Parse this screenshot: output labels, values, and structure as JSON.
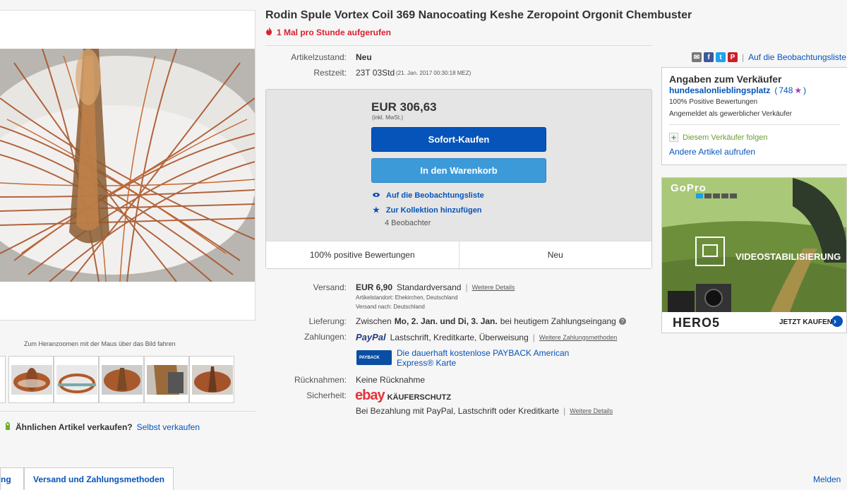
{
  "gallery": {
    "zoom_hint": "Zum Heranzoomen mit der Maus über das Bild fahren",
    "sell_question": "Ähnlichen Artikel verkaufen?",
    "sell_link": "Selbst verkaufen"
  },
  "tabs": {
    "tab1": "ng",
    "tab2": "Versand und Zahlungsmethoden",
    "report": "Melden"
  },
  "item": {
    "title": "Rodin Spule Vortex Coil 369 Nanocoating Keshe Zeropoint Orgonit Chembuster",
    "views": "1 Mal pro Stunde aufgerufen",
    "condition_label": "Artikelzustand:",
    "condition": "Neu",
    "time_label": "Restzeit:",
    "time_left": "23T 03Std",
    "end_date": "(21. Jan. 2017   00:30:18 MEZ)"
  },
  "share": {
    "watch_link": "Auf die Beobachtungsliste"
  },
  "buybox": {
    "price": "EUR 306,63",
    "vat": "(inkl. MwSt.)",
    "buy_now": "Sofort-Kaufen",
    "add_to_cart": "In den Warenkorb",
    "watchlist": "Auf die Beobachtungsliste",
    "collection": "Zur Kollektion hinzufügen",
    "watchers": "4 Beobachter",
    "positive": "100% positive Bewertungen",
    "condition": "Neu"
  },
  "shipping": {
    "label": "Versand:",
    "price": "EUR 6,90",
    "method": "Standardversand",
    "details": "Weitere Details",
    "location": "Artikelstandort:  Ehekirchen, Deutschland",
    "ships_to": "Versand nach:  Deutschland"
  },
  "delivery": {
    "label": "Lieferung:",
    "prefix": "Zwischen",
    "dates": "Mo, 2. Jan. und Di, 3. Jan.",
    "suffix": "bei heutigem Zahlungseingang"
  },
  "payments": {
    "label": "Zahlungen:",
    "paypal": "PayPal",
    "methods": "Lastschrift,  Kreditkarte,  Überweisung",
    "more": "Weitere Zahlungsmethoden",
    "payback_logo": "PAYBACK",
    "payback_text_1": "Die dauerhaft kostenlose PAYBACK American",
    "payback_text_2": "Express® Karte"
  },
  "returns": {
    "label": "Rücknahmen:",
    "value": "Keine Rücknahme"
  },
  "security": {
    "label": "Sicherheit:",
    "ebay": "ebay",
    "protection": "KÄUFERSCHUTZ",
    "text": "Bei Bezahlung mit PayPal, Lastschrift oder Kreditkarte",
    "details": "Weitere Details"
  },
  "seller": {
    "heading": "Angaben zum Verkäufer",
    "name": "hundesalonlieblingsplatz",
    "score_open": "(",
    "score": "748",
    "score_close": ")",
    "feedback": "100% Positive Bewertungen",
    "registered": "Angemeldet als gewerblicher Verkäufer",
    "follow": "Diesem Verkäufer folgen",
    "other_items": "Andere Artikel aufrufen"
  },
  "ad": {
    "brand": "GoPro",
    "feature": "VIDEOSTABILISIERUNG",
    "model": "HERO5",
    "cta": "JETZT KAUFEN"
  },
  "colors": {
    "link": "#0654ba",
    "buy_button": "#0654ba",
    "cart_button": "#3d9ad9",
    "alert": "#dd1e31"
  }
}
